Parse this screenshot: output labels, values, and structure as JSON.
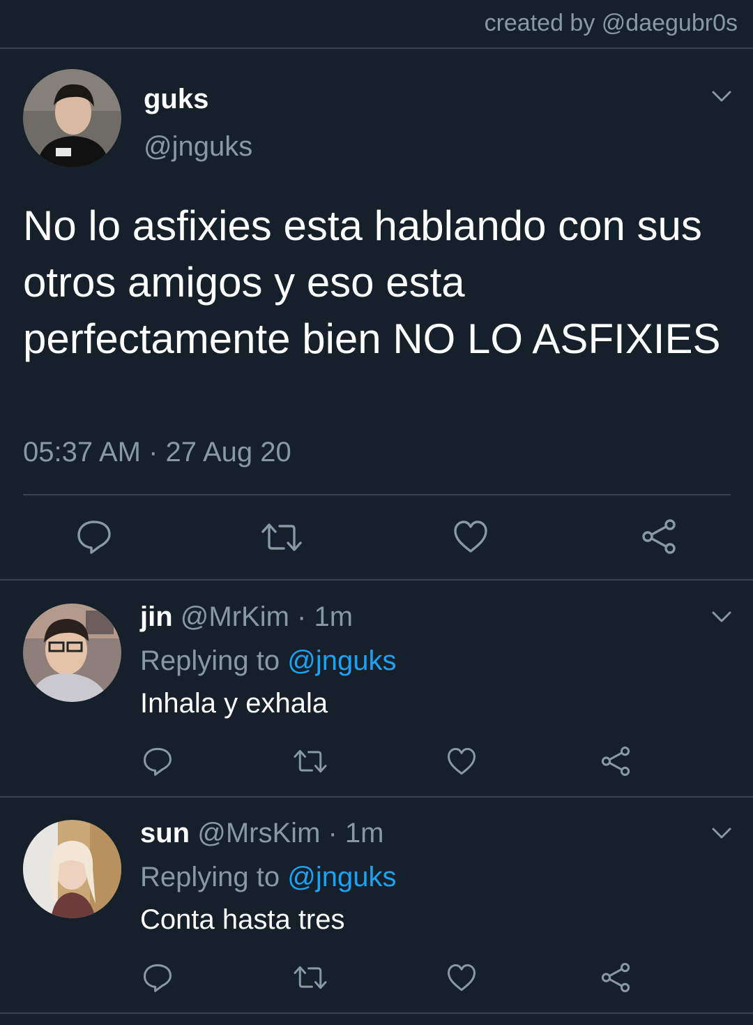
{
  "header": {
    "credit": "created by @daegubr0s"
  },
  "tweet": {
    "author_name": "guks",
    "author_handle": "@jnguks",
    "text": "No lo asfixies esta hablando con sus otros amigos y eso esta perfectamente bien NO LO ASFIXIES",
    "timestamp": "05:37 AM · 27 Aug 20",
    "actions": [
      "reply-icon",
      "retweet-icon",
      "like-icon",
      "share-icon"
    ]
  },
  "replies": [
    {
      "name": "jin",
      "meta": "@MrKim · 1m",
      "replying_label": "Replying to",
      "replying_to": "@jnguks",
      "text": "Inhala y exhala"
    },
    {
      "name": "sun",
      "meta": "@MrsKim · 1m",
      "replying_label": "Replying to",
      "replying_to": "@jnguks",
      "text": "Conta hasta tres"
    }
  ],
  "colors": {
    "background": "#15202b",
    "secondary_text": "#8899a6",
    "accent": "#1da1f2",
    "divider": "#38444d"
  }
}
